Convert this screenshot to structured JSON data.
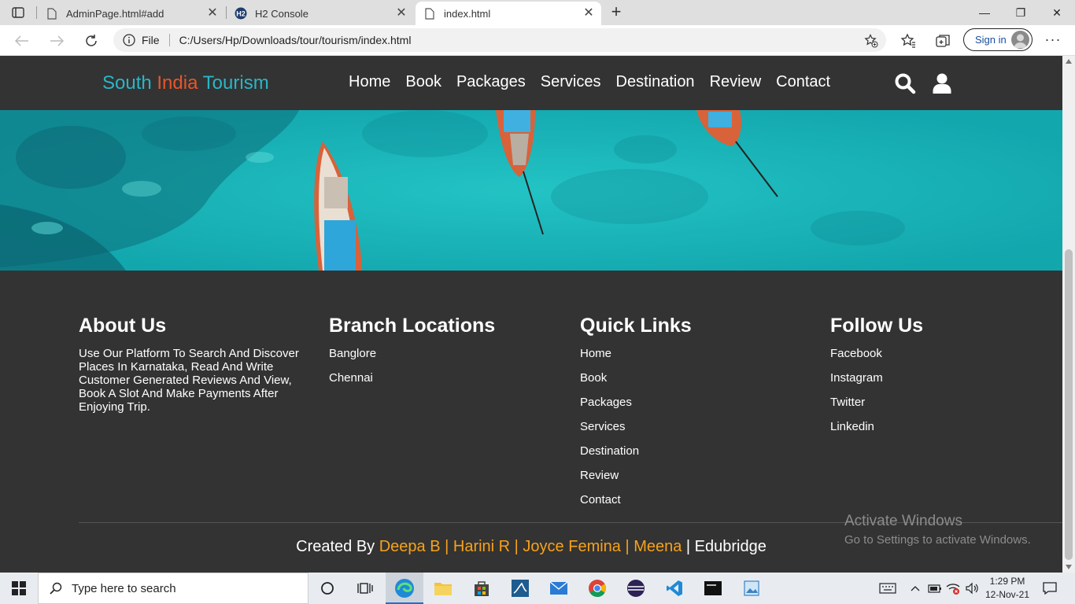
{
  "browser": {
    "tabs": [
      {
        "title": "AdminPage.html#add",
        "close": "✕"
      },
      {
        "title": "H2 Console",
        "close": "✕"
      },
      {
        "title": "index.html",
        "close": "✕"
      }
    ],
    "new_tab": "+",
    "window_controls": {
      "minimize": "—",
      "maximize": "❐",
      "close": "✕"
    },
    "address": {
      "scheme_label": "File",
      "url": "C:/Users/Hp/Downloads/tour/tourism/index.html"
    },
    "signin_label": "Sign in",
    "more": "···"
  },
  "site": {
    "logo": {
      "part1": "South ",
      "part2": "India",
      "part3": " Tourism"
    },
    "nav": [
      "Home",
      "Book",
      "Packages",
      "Services",
      "Destination",
      "Review",
      "Contact"
    ],
    "colors": {
      "logo": "#29b6c8",
      "logo_accent": "#e8562a",
      "names": "#f7a21a",
      "bg": "#333333"
    }
  },
  "footer": {
    "about": {
      "heading": "About Us",
      "text": "Use Our Platform To Search And Discover Places In Karnataka, Read And Write Customer Generated Reviews And View, Book A Slot And Make Payments After Enjoying Trip."
    },
    "branches": {
      "heading": "Branch Locations",
      "items": [
        "Banglore",
        "Chennai"
      ]
    },
    "quick_links": {
      "heading": "Quick Links",
      "items": [
        "Home",
        "Book",
        "Packages",
        "Services",
        "Destination",
        "Review",
        "Contact"
      ]
    },
    "follow": {
      "heading": "Follow Us",
      "items": [
        "Facebook",
        "Instagram",
        "Twitter",
        "Linkedin"
      ]
    },
    "credit": {
      "prefix": "Created By ",
      "names": "Deepa B | Harini R | Joyce Femina | Meena",
      "suffix": " | Edubridge"
    }
  },
  "watermark": {
    "line1": "Activate Windows",
    "line2": "Go to Settings to activate Windows."
  },
  "taskbar": {
    "search_placeholder": "Type here to search",
    "time": "1:29 PM",
    "date": "12-Nov-21"
  }
}
